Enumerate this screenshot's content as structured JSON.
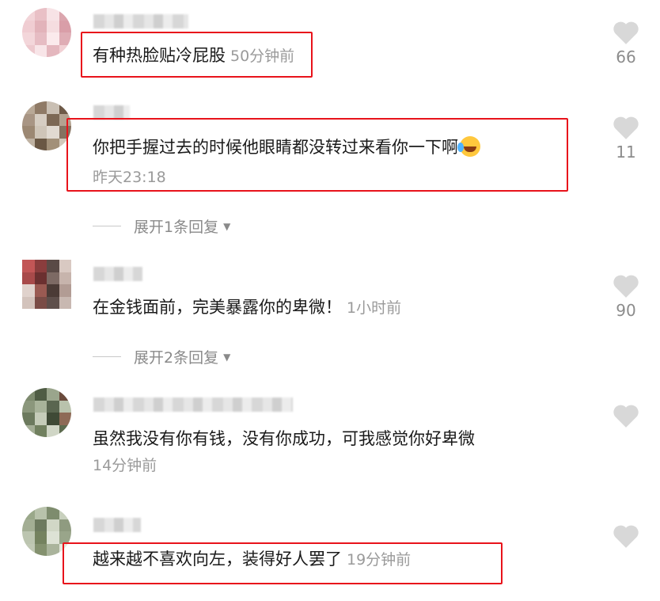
{
  "comments": [
    {
      "text": "有种热脸贴冷屁股",
      "time": "50分钟前",
      "likes": "66",
      "avatar_colors": [
        "#f2d4d8",
        "#e9c0c6",
        "#f7e3e6",
        "#dba6ae",
        "#f0cdd2",
        "#e2b3ba",
        "#f5dde0",
        "#d99ea8",
        "#f3d6da",
        "#e6bcc3",
        "#fbeaec",
        "#dfadb5",
        "#edc9ce",
        "#f8e5e8",
        "#e4b7be",
        "#f1d0d4"
      ]
    },
    {
      "text": "你把手握过去的时候他眼睛都没转过来看你一下啊",
      "time": "昨天23:18",
      "likes": "11",
      "emoji": "face-with-tears-of-joy-icon",
      "avatar_colors": [
        "#b8a896",
        "#8f7a66",
        "#c9bfb3",
        "#6e5a48",
        "#a89584",
        "#d6cdc2",
        "#7c6855",
        "#b3a290",
        "#9c8873",
        "#cfc5b8",
        "#e1dad1",
        "#857260",
        "#bfb2a2",
        "#6a5744",
        "#a29079",
        "#d2c8bb"
      ]
    },
    {
      "text": "在金钱面前，完美暴露你的卑微！",
      "time": "1小时前",
      "likes": "90",
      "avatar_colors": [
        "#c25656",
        "#8a3d3d",
        "#5a4a46",
        "#d9c9c2",
        "#a84a4a",
        "#6b3030",
        "#7d6a64",
        "#c7b4ac",
        "#e0d2cc",
        "#9a5a52",
        "#4b3b36",
        "#b29c94",
        "#d3c3bc",
        "#7a4c46",
        "#5e4f4b",
        "#c8b8b1"
      ]
    },
    {
      "text": "虽然我没有你有钱，没有你成功，可我感觉你好卑微",
      "time": "14分钟前",
      "likes": "",
      "avatar_colors": [
        "#7d8a6e",
        "#4f5c44",
        "#9aa58c",
        "#6a4a3c",
        "#8b977c",
        "#a8b39a",
        "#5a6650",
        "#b9c2ac",
        "#6c7a5e",
        "#c5ccb9",
        "#3f4a36",
        "#8e6a56",
        "#a3ad95",
        "#71805f",
        "#d0d6c6",
        "#5d6b4f"
      ]
    },
    {
      "text": "越来越不喜欢向左，装得好人罢了",
      "time": "19分钟前",
      "likes": "",
      "avatar_colors": [
        "#9aa88a",
        "#b8c2ab",
        "#7e8c6e",
        "#c8d0bd",
        "#a3ae94",
        "#6d7a5f",
        "#d1d7c6",
        "#8f9b80",
        "#bcc5b0",
        "#74825f",
        "#dde2d5",
        "#99a58a",
        "#c0c8b4",
        "#84916f",
        "#aab49c",
        "#e4e8dd"
      ]
    }
  ],
  "replies": [
    {
      "label": "展开1条回复"
    },
    {
      "label": "展开2条回复"
    }
  ],
  "colors": {
    "highlight": "#e8131b",
    "text": "#1a1a1a",
    "meta": "#9a9a9a",
    "heart": "#d8d8d8"
  },
  "icons": {
    "like": "heart-icon",
    "expand": "caret-down-icon"
  }
}
